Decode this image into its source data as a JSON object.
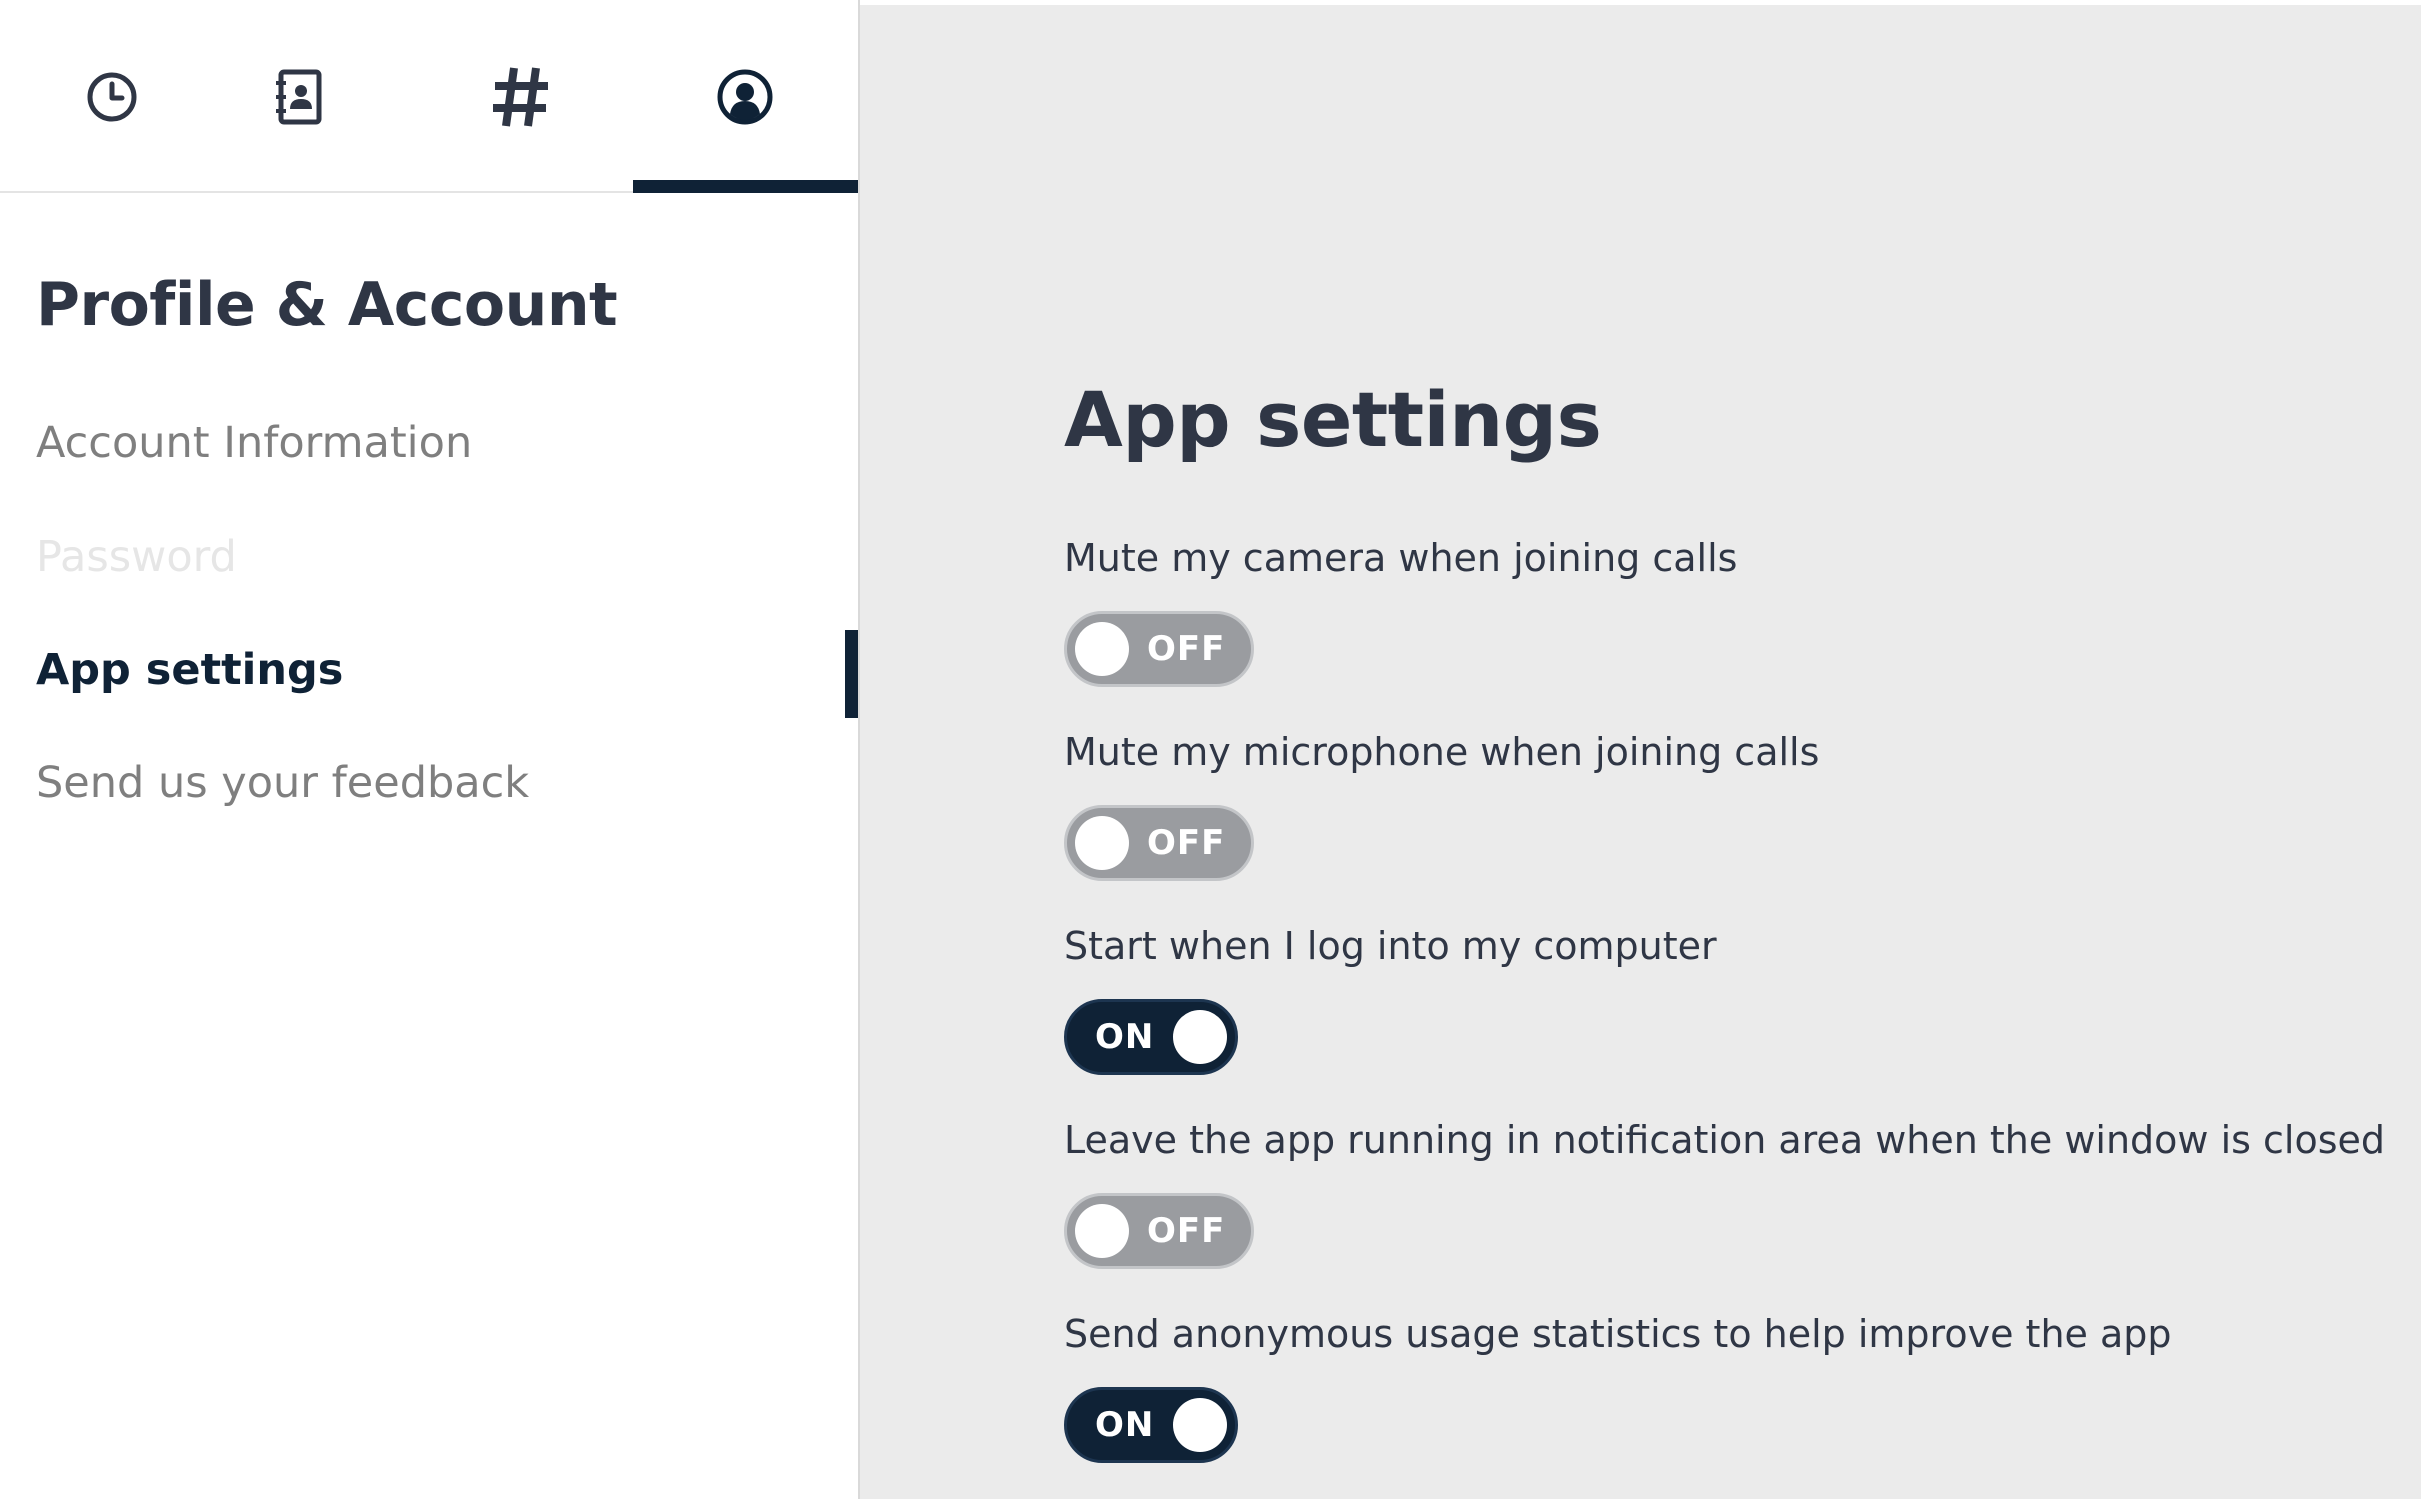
{
  "colors": {
    "primary_dark": "#0f2236",
    "toggle_off": "#9a9ca0",
    "main_background": "#ebebeb",
    "text": "#2f3645"
  },
  "tabs": [
    {
      "name": "recents",
      "icon": "clock-icon"
    },
    {
      "name": "contacts",
      "icon": "address-book-icon"
    },
    {
      "name": "channels",
      "icon": "hashtag-icon"
    },
    {
      "name": "profile",
      "icon": "user-circle-icon",
      "active": true
    }
  ],
  "sidebar": {
    "title": "Profile & Account",
    "items": [
      {
        "label": "Account Information",
        "state": "default"
      },
      {
        "label": "Password",
        "state": "disabled"
      },
      {
        "label": "App settings",
        "state": "active"
      },
      {
        "label": "Send us your feedback",
        "state": "default"
      }
    ]
  },
  "main": {
    "title": "App settings",
    "settings": [
      {
        "label": "Mute my camera when joining calls",
        "value": "OFF",
        "on": false
      },
      {
        "label": "Mute my microphone when joining calls",
        "value": "OFF",
        "on": false
      },
      {
        "label": "Start when I log into my computer",
        "value": "ON",
        "on": true
      },
      {
        "label": "Leave the app running in notification area when the window is closed",
        "value": "OFF",
        "on": false
      },
      {
        "label": "Send anonymous usage statistics to help improve the app",
        "value": "ON",
        "on": true
      }
    ]
  }
}
